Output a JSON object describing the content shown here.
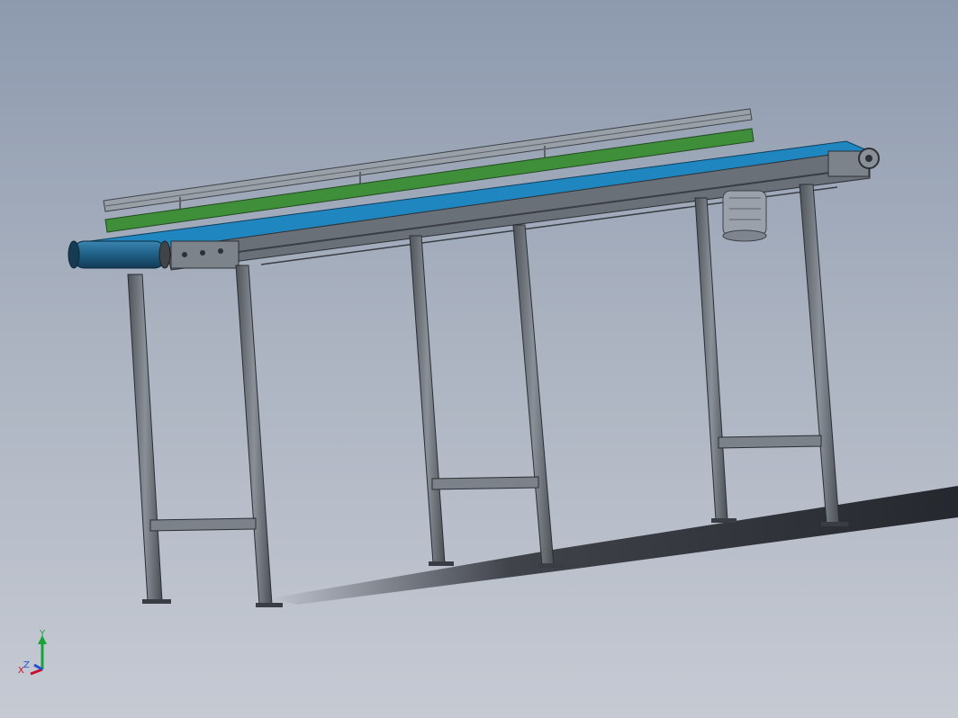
{
  "viewport": {
    "model": "belt-conveyor",
    "background_colors": [
      "#8d9aae",
      "#c6cad3"
    ]
  },
  "model": {
    "belt_color": "#1f86c0",
    "side_rail_color": "#3f8f3a",
    "guard_rail_color": "#8e949c",
    "frame_color": "#5f646b",
    "leg_color": "#6c727a",
    "motor_color": "#9aa1aa",
    "leg_count": 6,
    "drive_motor": "motor-icon"
  },
  "triad": {
    "x_label": "X",
    "y_label": "Y",
    "z_label": "Z",
    "x_color": "#c8102e",
    "y_color": "#1aa33b",
    "z_color": "#1f4fd1"
  }
}
